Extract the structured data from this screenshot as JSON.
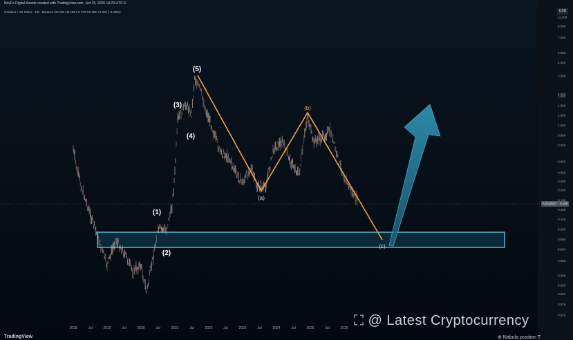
{
  "header": {
    "title": "NovFx-Digital-Assets created with TradingView.com, Jun 15, 2026 14:23 UTC-5",
    "symbol_line": "Cardano / US Dollar · 1W · Binance  O0.183  H0.190  L0.179  C0.185  +0.002 (+1.09%)"
  },
  "axis": {
    "currency": "USD",
    "price_tag": "ADAUSDT · 0.185"
  },
  "watermark": "⛶ @ Latest Cryptocurrency",
  "footer": {
    "logo": "TradingView",
    "position_text": "⊕ Nabula position  T"
  },
  "chart_data": {
    "type": "line",
    "title": "Cardano / US Dollar · 1W · Binance",
    "xlabel": "",
    "ylabel": "",
    "y_scale": "log",
    "y_ticks": [
      "11.000",
      "9.000",
      "7.000",
      "5.000",
      "4.000",
      "3.000",
      "2.000",
      "1.900",
      "1.550",
      "1.250",
      "1.000",
      "0.800",
      "0.650",
      "0.450",
      "0.350",
      "0.290",
      "0.240",
      "0.190",
      "0.155",
      "0.125",
      "0.100",
      "0.080",
      "0.064",
      "0.050",
      "0.036",
      "0.029",
      "0.024",
      "0.019",
      "0.015"
    ],
    "x_ticks": [
      "2018",
      "Jul",
      "2019",
      "Jul",
      "2020",
      "Jul",
      "2021",
      "Jul",
      "2022",
      "Jul",
      "2023",
      "Jul",
      "2024",
      "Jul",
      "2025",
      "Jul",
      "2026"
    ],
    "support_zone": {
      "low": 0.068,
      "high": 0.098
    },
    "elliott_waves": [
      {
        "label": "(1)",
        "date": "2020-12",
        "price": 0.17
      },
      {
        "label": "(2)",
        "date": "2020-12",
        "price": 0.07
      },
      {
        "label": "(3)",
        "date": "2021-03",
        "price": 1.5
      },
      {
        "label": "(4)",
        "date": "2021-03",
        "price": 0.95
      },
      {
        "label": "(5)",
        "date": "2021-08",
        "price": 2.9
      }
    ],
    "correction": [
      {
        "label": "(a)",
        "date": "2023-06",
        "price": 0.26
      },
      {
        "label": "(b)",
        "date": "2024-12",
        "price": 1.25
      },
      {
        "label": "(c)",
        "date": "2026-09",
        "price": 0.085
      }
    ],
    "projection": {
      "from_date": "2026-09",
      "from_price": 0.085,
      "to_date": "2027-06",
      "to_price": 1.6
    },
    "current_price": 0.185,
    "colors": {
      "background": "#050b12",
      "candles": "#8a7a76",
      "path": "#f0a24a",
      "zone": "#4fc3e0",
      "arrow": "#2a7f9c"
    }
  }
}
